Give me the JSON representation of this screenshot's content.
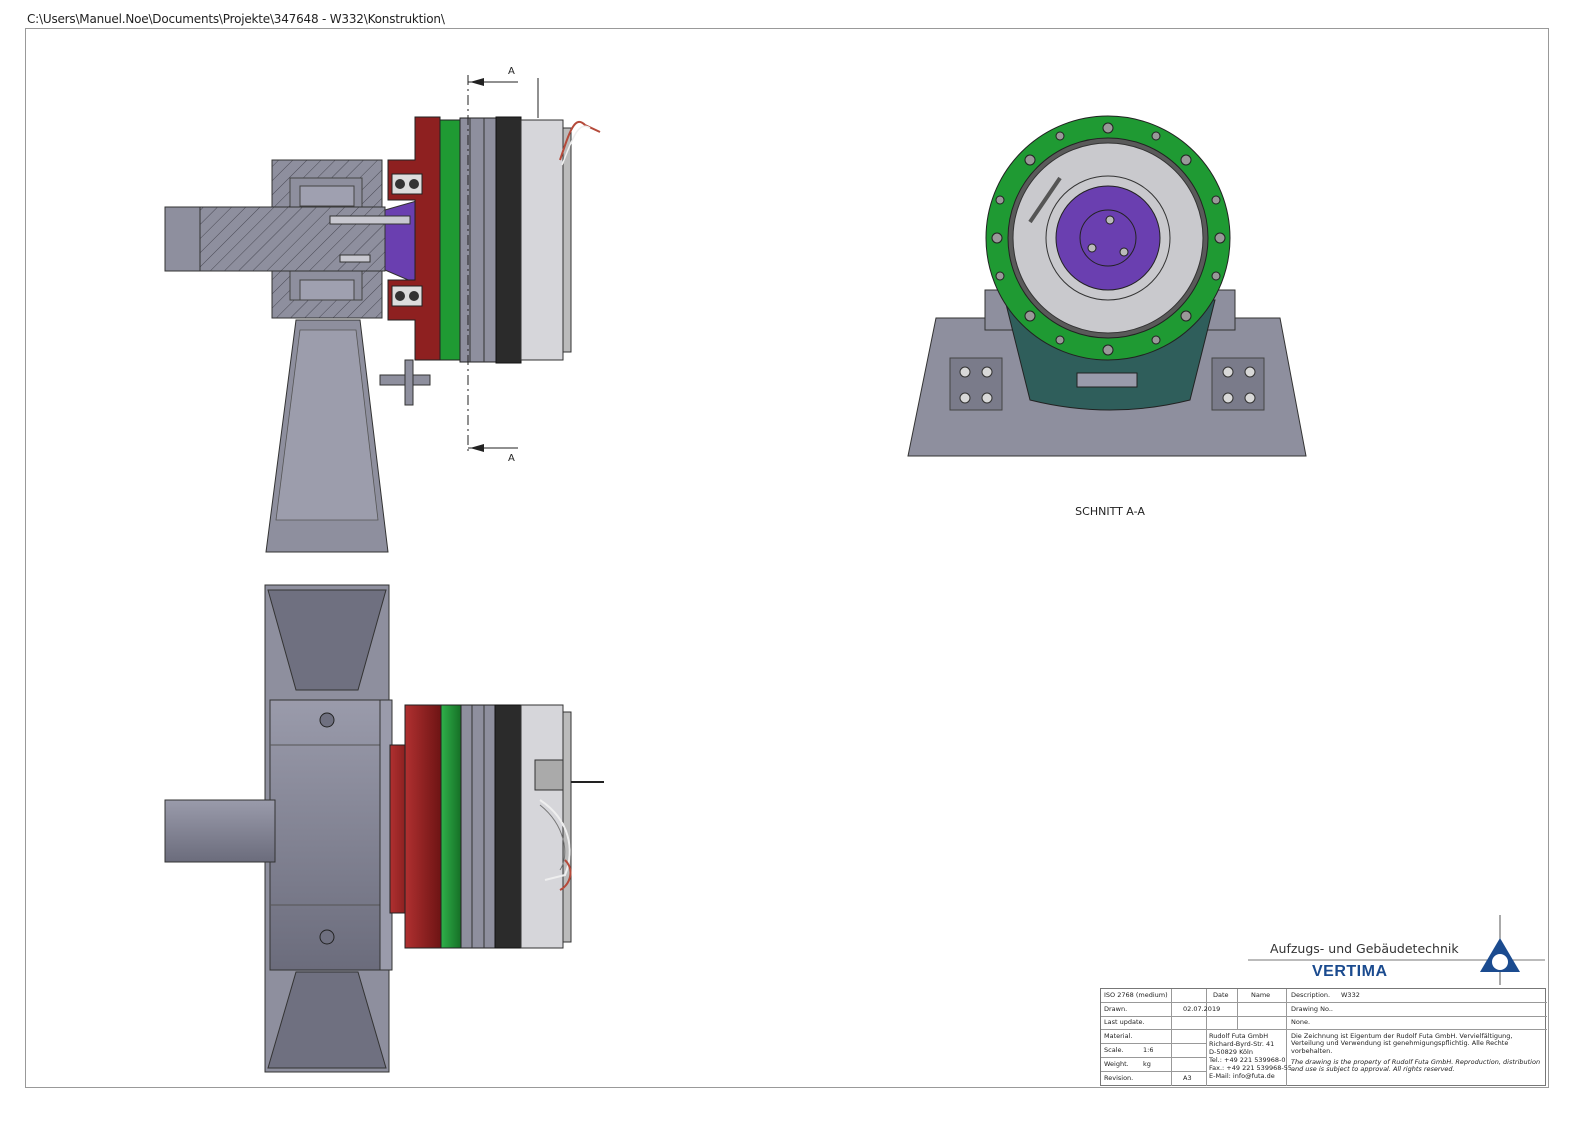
{
  "window_path": "C:\\Users\\Manuel.Noe\\Documents\\Projekte\\347648 - W332\\Konstruktion\\",
  "section_marker": "A",
  "section_label": "SCHNITT A-A",
  "brand": {
    "subtitle": "Aufzugs- und Gebäudetechnik",
    "name": "VERTIMA",
    "color": "#1b4b8f"
  },
  "title_block": {
    "tolerance": "ISO 2768 (medium)",
    "date_header": "Date",
    "name_header": "Name",
    "description_label": "Description.",
    "description_value": "W332",
    "drawn_label": "Drawn.",
    "drawn_date": "02.07.2019",
    "drawing_no_label": "Drawing No..",
    "last_update_label": "Last update.",
    "none_value": "None.",
    "material_label": "Material.",
    "scale_label": "Scale.",
    "scale_value": "1:6",
    "weight_label": "Weight.",
    "weight_unit": "kg",
    "revision_label": "Revision.",
    "format_value": "A3",
    "company_lines": [
      "Rudolf Futa GmbH",
      "Richard-Byrd-Str. 41",
      "D-50829 Köln",
      "Tel.: +49 221 539968-0",
      "Fax.: +49 221 539968-55",
      "E-Mail: info@futa.de"
    ],
    "note_de": "Die Zeichnung ist Eigentum der Rudolf Futa GmbH. Vervielfältigung, Verteilung und Verwendung ist genehmigungspflichtig. Alle Rechte vorbehalten.",
    "note_en": "The drawing is the property of Rudolf Futa GmbH. Reproduction, distribution and use is subject to approval. All rights reserved."
  },
  "colors": {
    "gray": "#8e8f9e",
    "gray_dark": "#6f7080",
    "red": "#8e2020",
    "green": "#1f9a33",
    "purple": "#6a3fb0",
    "black": "#2b2b2b",
    "silver": "#d6d6da",
    "teal": "#2f5e5b"
  }
}
